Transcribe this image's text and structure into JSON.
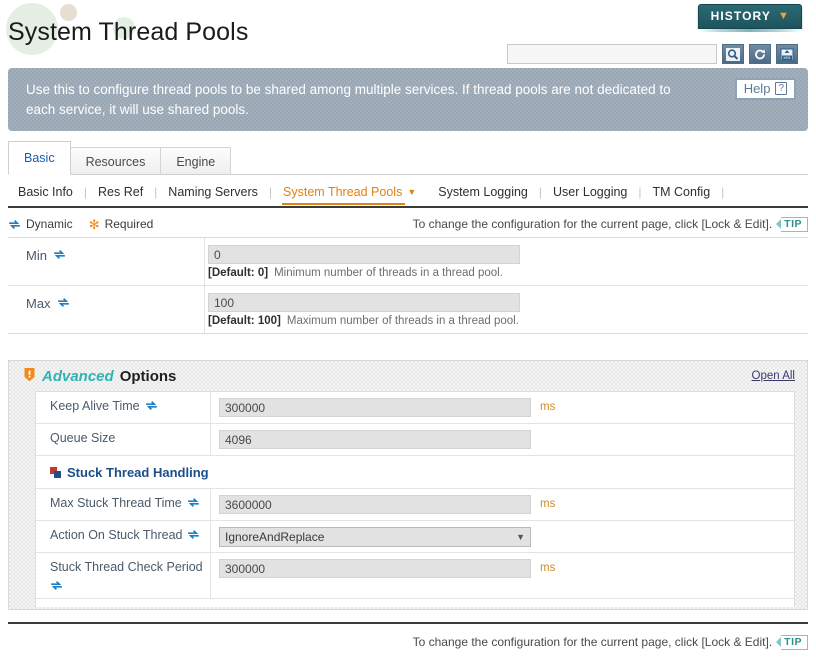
{
  "page": {
    "title": "System Thread Pools"
  },
  "header": {
    "history_label": "HISTORY",
    "history_caret": "▼",
    "search_placeholder": "",
    "search_value": "",
    "tools": [
      {
        "name": "search-icon",
        "title": "Search"
      },
      {
        "name": "refresh-icon",
        "title": "Refresh"
      },
      {
        "name": "xml-export-icon",
        "title": "Export XML"
      }
    ]
  },
  "banner": {
    "text": "Use this to configure thread pools to be shared among multiple services. If thread pools are not dedicated to each service, it will use shared pools.",
    "help_label": "Help",
    "help_glyph": "?"
  },
  "tabs": [
    {
      "label": "Basic",
      "active": true
    },
    {
      "label": "Resources",
      "active": false
    },
    {
      "label": "Engine",
      "active": false
    }
  ],
  "subtabs": [
    {
      "label": "Basic Info",
      "active": false
    },
    {
      "label": "Res Ref",
      "active": false
    },
    {
      "label": "Naming Servers",
      "active": false
    },
    {
      "label": "System Thread Pools",
      "active": true
    },
    {
      "label": "System Logging",
      "active": false
    },
    {
      "label": "User Logging",
      "active": false
    },
    {
      "label": "TM Config",
      "active": false
    }
  ],
  "legend": {
    "dynamic_label": "Dynamic",
    "required_label": "Required",
    "required_glyph": "✻"
  },
  "tip": {
    "text": "To change the configuration for the current page, click [Lock & Edit].",
    "badge": "TIP"
  },
  "basic_fields": [
    {
      "label": "Min",
      "dynamic": true,
      "value": "0",
      "default_label": "[Default: 0]",
      "description": "Minimum number of threads in a thread pool."
    },
    {
      "label": "Max",
      "dynamic": true,
      "value": "100",
      "default_label": "[Default: 100]",
      "description": "Maximum number of threads in a thread pool."
    }
  ],
  "advanced": {
    "title_emphasis": "Advanced",
    "title_rest": "Options",
    "open_all": "Open All",
    "fields": [
      {
        "label": "Keep Alive Time",
        "dynamic": true,
        "value": "300000",
        "unit": "ms",
        "type": "text"
      },
      {
        "label": "Queue Size",
        "dynamic": false,
        "value": "4096",
        "unit": "",
        "type": "text"
      }
    ],
    "section": {
      "title": "Stuck Thread Handling",
      "fields": [
        {
          "label": "Max Stuck Thread Time",
          "dynamic": true,
          "value": "3600000",
          "unit": "ms",
          "type": "text"
        },
        {
          "label": "Action On Stuck Thread",
          "dynamic": true,
          "value": "IgnoreAndReplace",
          "unit": "",
          "type": "select",
          "caret": "▼"
        },
        {
          "label": "Stuck Thread Check Period",
          "dynamic": true,
          "value": "300000",
          "unit": "ms",
          "type": "text"
        }
      ]
    }
  },
  "footer": {
    "text": "To change the configuration for the current page, click [Lock & Edit].",
    "badge": "TIP"
  },
  "colors": {
    "accent_orange": "#e08214",
    "teal": "#2fb3b3",
    "history_teal": "#1e545d",
    "banner_grey": "#99a7b4",
    "label_blue": "#4a5a6a",
    "link_blue": "#1861ac"
  }
}
